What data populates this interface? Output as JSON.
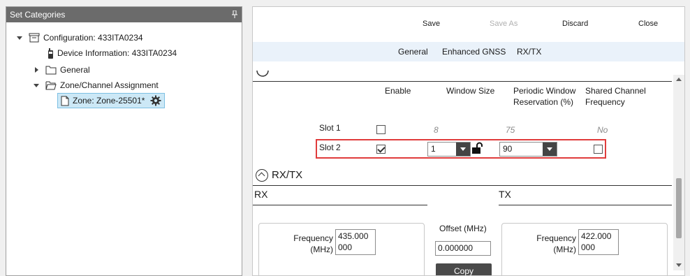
{
  "left_panel": {
    "title": "Set Categories",
    "tree": {
      "configuration": "Configuration: 433ITA0234",
      "device_info": "Device Information: 433ITA0234",
      "general": "General",
      "zone_channel": "Zone/Channel Assignment",
      "zone": "Zone: Zone-25501*"
    }
  },
  "toolbar": {
    "save": "Save",
    "save_as": "Save As",
    "discard": "Discard",
    "close": "Close"
  },
  "tabs": [
    "General",
    "Enhanced GNSS",
    "RX/TX"
  ],
  "slot_table": {
    "headers": {
      "enable": "Enable",
      "window_size": "Window Size",
      "periodic": "Periodic Window Reservation (%)",
      "shared": "Shared Channel Frequency"
    },
    "slot1": {
      "label": "Slot 1",
      "enabled": false,
      "window_size": "8",
      "periodic": "75",
      "shared": "No"
    },
    "slot2": {
      "label": "Slot 2",
      "enabled": true,
      "window_size": "1",
      "periodic": "90",
      "shared": false
    }
  },
  "rxtx": {
    "title": "RX/TX",
    "rx_label": "RX",
    "tx_label": "TX",
    "rx_freq_label": "Frequency (MHz)",
    "rx_freq_value": "435.000000",
    "offset_label": "Offset (MHz)",
    "offset_value": "0.000000",
    "copy_label": "Copy",
    "tx_freq_label": "Frequency (MHz)",
    "tx_freq_value": "422.000000"
  },
  "colors": {
    "header_bg": "#6b6b6b",
    "selected_bg": "#cce8f6",
    "highlight_border": "#e03c3c",
    "tabs_bg": "#eaf2fa"
  }
}
